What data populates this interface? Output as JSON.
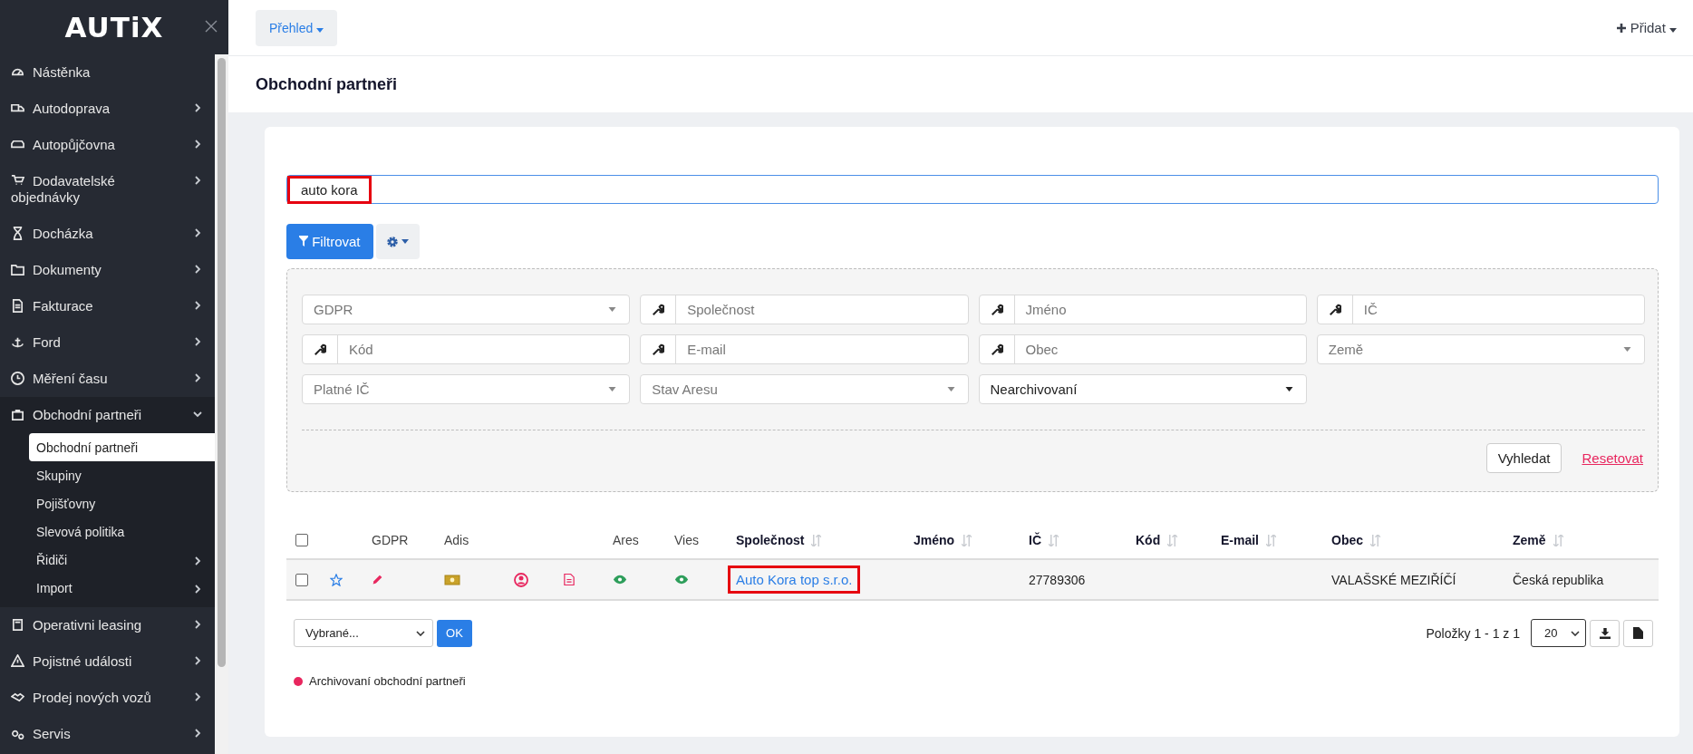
{
  "sidebar": {
    "logo": "AUTiX",
    "items": [
      {
        "label": "Nástěnka",
        "kind": "link"
      },
      {
        "label": "Autodoprava",
        "kind": "group",
        "expanded": false
      },
      {
        "label": "Autopůjčovna",
        "kind": "group",
        "expanded": false
      },
      {
        "label": "Dodavatelské objednávky",
        "kind": "group",
        "expanded": false
      },
      {
        "label": "Docházka",
        "kind": "group",
        "expanded": false
      },
      {
        "label": "Dokumenty",
        "kind": "group",
        "expanded": false
      },
      {
        "label": "Fakturace",
        "kind": "group",
        "expanded": false
      },
      {
        "label": "Ford",
        "kind": "group",
        "expanded": false
      },
      {
        "label": "Měření času",
        "kind": "group",
        "expanded": false
      },
      {
        "label": "Obchodní partneři",
        "kind": "group",
        "expanded": true,
        "children": [
          {
            "label": "Obchodní partneři",
            "kind": "link",
            "selected": true
          },
          {
            "label": "Skupiny",
            "kind": "link",
            "selected": false
          },
          {
            "label": "Pojišťovny",
            "kind": "link",
            "selected": false
          },
          {
            "label": "Slevová politika",
            "kind": "link",
            "selected": false
          },
          {
            "label": "Řidiči",
            "kind": "group",
            "selected": false
          },
          {
            "label": "Import",
            "kind": "group",
            "selected": false
          }
        ]
      },
      {
        "label": "Operativni leasing",
        "kind": "group",
        "expanded": false
      },
      {
        "label": "Pojistné události",
        "kind": "group",
        "expanded": false
      },
      {
        "label": "Prodej nových vozů",
        "kind": "group",
        "expanded": false
      },
      {
        "label": "Servis",
        "kind": "group",
        "expanded": false
      }
    ]
  },
  "topbar": {
    "overview_button": "Přehled",
    "add_button": "Přidat"
  },
  "page_title": "Obchodní partneři",
  "search": {
    "value": "auto kora",
    "highlighted": true
  },
  "filter_button": "Filtrovat",
  "filters": [
    {
      "kind": "select",
      "placeholder": "GDPR"
    },
    {
      "kind": "text",
      "placeholder": "Společnost"
    },
    {
      "kind": "text",
      "placeholder": "Jméno"
    },
    {
      "kind": "text",
      "placeholder": "IČ"
    },
    {
      "kind": "text",
      "placeholder": "Kód"
    },
    {
      "kind": "text",
      "placeholder": "E-mail"
    },
    {
      "kind": "text",
      "placeholder": "Obec"
    },
    {
      "kind": "select",
      "placeholder": "Země"
    },
    {
      "kind": "select",
      "placeholder": "Platné IČ"
    },
    {
      "kind": "select",
      "placeholder": "Stav Aresu"
    },
    {
      "kind": "select",
      "value": "Nearchivovaní"
    }
  ],
  "search_button": "Vyhledat",
  "reset_link": "Resetovat",
  "table": {
    "select_all_checked": false,
    "columns": [
      {
        "kind": "blank"
      },
      {
        "kind": "label",
        "label": "GDPR",
        "sortable": false
      },
      {
        "kind": "label",
        "label": "Adis",
        "sortable": false
      },
      {
        "kind": "blank"
      },
      {
        "kind": "blank"
      },
      {
        "kind": "label",
        "label": "Ares",
        "sortable": false
      },
      {
        "kind": "label",
        "label": "Vies",
        "sortable": false
      },
      {
        "kind": "label",
        "label": "Společnost",
        "sortable": true
      },
      {
        "kind": "label",
        "label": "Jméno",
        "sortable": true
      },
      {
        "kind": "label",
        "label": "IČ",
        "sortable": true
      },
      {
        "kind": "label",
        "label": "Kód",
        "sortable": true
      },
      {
        "kind": "label",
        "label": "E-mail",
        "sortable": true
      },
      {
        "kind": "label",
        "label": "Obec",
        "sortable": true
      },
      {
        "kind": "label",
        "label": "Země",
        "sortable": true
      }
    ],
    "rows": [
      {
        "checked": false,
        "company": "Auto Kora top s.r.o.",
        "company_highlighted": true,
        "ic": "27789306",
        "obec": "VALAŠSKÉ MEZIŘÍČÍ",
        "zeme": "Česká republika"
      }
    ]
  },
  "bulk_select": "Vybrané...",
  "ok_button": "OK",
  "pagination": {
    "summary": "Položky 1 - 1 z 1",
    "page_size": "20"
  },
  "legend": [
    {
      "label": "Archivovaní obchodní partneři",
      "color": "#e8265e"
    }
  ]
}
